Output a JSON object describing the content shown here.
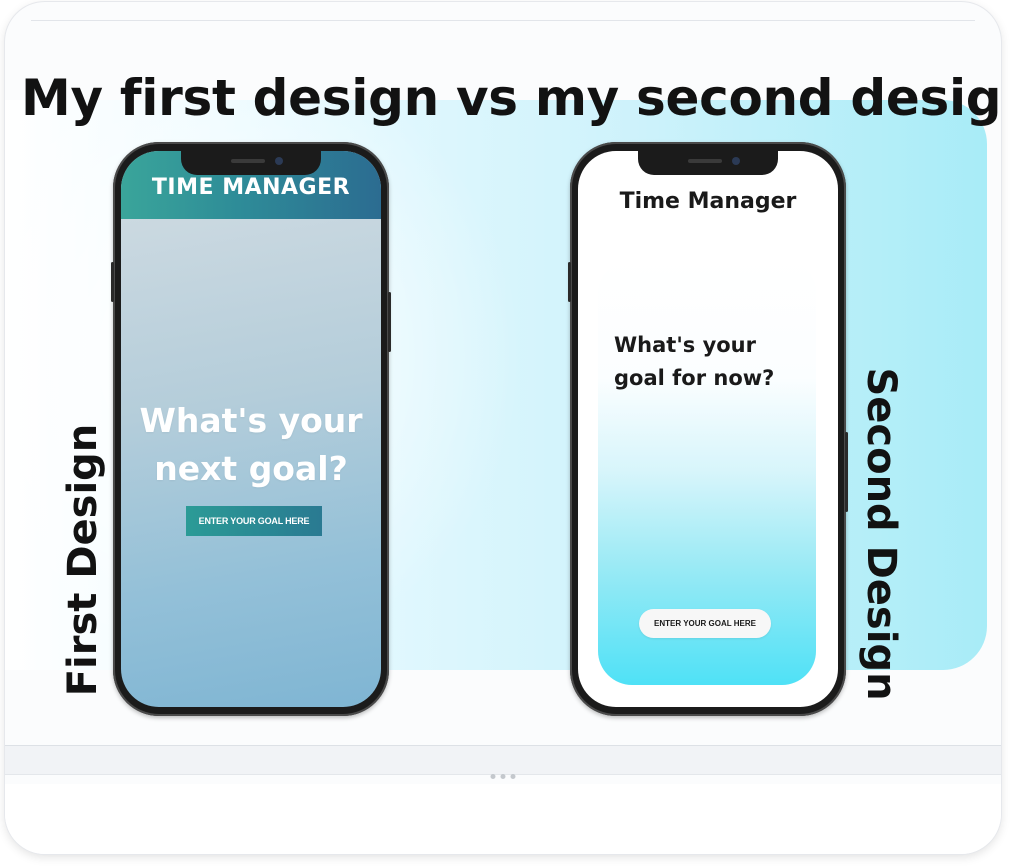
{
  "slide": {
    "title": "My first design vs my second design",
    "left_label": "First Design",
    "right_label": "Second Design"
  },
  "first_design": {
    "header_title": "TIME MANAGER",
    "question": "What's your next goal?",
    "button_label": "ENTER YOUR GOAL HERE"
  },
  "second_design": {
    "header_title": "Time Manager",
    "question": "What's your goal for now?",
    "button_label": "ENTER YOUR GOAL HERE"
  },
  "colors": {
    "first_header": "#2e8c98",
    "second_card_accent": "#4fe1f6",
    "backdrop": "#a8ecf7"
  }
}
